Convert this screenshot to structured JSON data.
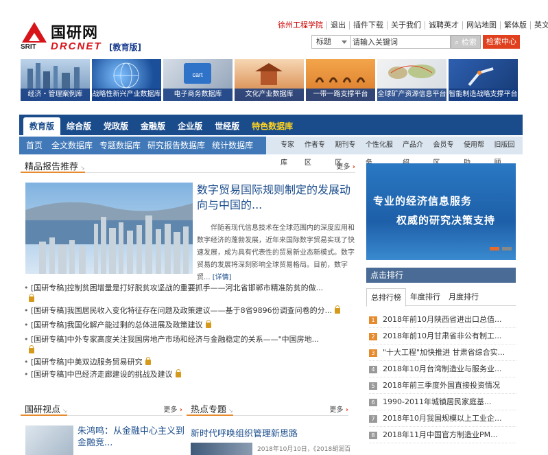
{
  "toplinks": [
    "徐州工程学院",
    "退出",
    "插件下载",
    "关于我们",
    "诚聘英才",
    "网站地图",
    "繁体版",
    "英文版"
  ],
  "logo": {
    "srit": "SRIT",
    "cn": "国研网",
    "en": "DRCNET",
    "edition": "[教育版]"
  },
  "search": {
    "select": "标题",
    "placeholder": "请输入关键词",
    "button": "检索",
    "center": "检索中心"
  },
  "banners": [
    "经济・管理案例库",
    "战略性新兴产业数据库",
    "电子商务数据库",
    "文化产业数据库",
    "一带一路支撑平台",
    "全球矿产资源信息平台",
    "智能制造战略支撑平台"
  ],
  "nav1": [
    "教育版",
    "综合版",
    "党政版",
    "金融版",
    "企业版",
    "世经版",
    "特色数据库"
  ],
  "nav2": {
    "main": [
      "首页",
      "全文数据库",
      "专题数据库",
      "研究报告数据库",
      "统计数据库"
    ],
    "subs": [
      "专家库",
      "作者专区",
      "期刊专区",
      "个性化服务",
      "产品介绍",
      "会员专区",
      "使用帮助",
      "旧版回顾"
    ]
  },
  "section1": {
    "title": "精品报告推荐",
    "more": "更多"
  },
  "featured": {
    "title": "数字贸易国际规则制定的发展动向与中国的...",
    "summary": "伴随着现代信息技术在全球范围内的深度应用和数字经济的蓬勃发展，近年来国际数字贸易实现了快速发展，成为具有代表性的贸易新业态新模式。数字贸易的发展将深刻影响全球贸易格局。目前，数字贸...",
    "detail": "[详情]"
  },
  "news": [
    "[国研专稿]控制贫困增量是打好脱贫攻坚战的重要抓手——河北省邯郸市精准防贫的做...",
    "[国研专稿]我国居民收入变化特征存在问题及政策建议——基于8省9896份调查问卷的分...",
    "[国研专稿]我国化解产能过剩的总体进展及政策建议",
    "[国研专稿]中外专家高度关注我国房地产市场和经济与金融稳定的关系——\"中国房地...",
    "[国研专稿]中美双边服务贸易研究",
    "[国研专稿]中巴经济走廊建设的挑战及建议"
  ],
  "promo": {
    "line1": "专业的经济信息服务",
    "line2": "权威的研究决策支持"
  },
  "rank": {
    "header": "点击排行",
    "tabs": [
      "总排行榜",
      "年度排行",
      "月度排行"
    ],
    "items": [
      {
        "n": "1",
        "t": "2018年前10月陕西省进出口总值..."
      },
      {
        "n": "2",
        "t": "2018年前10月甘肃省非公有制工..."
      },
      {
        "n": "3",
        "t": "\"十大工程\"加快推进 甘肃省综合实..."
      },
      {
        "n": "4",
        "t": "2018年10月台湾制造业与服务业..."
      },
      {
        "n": "5",
        "t": "2018年前三季度外国直接投资情况"
      },
      {
        "n": "6",
        "t": "1990-2011年城镇居民家庭基..."
      },
      {
        "n": "7",
        "t": "2018年10月我国规模以上工业企..."
      },
      {
        "n": "8",
        "t": "2018年11月中国官方制造业PM..."
      }
    ]
  },
  "section2": {
    "title": "国研视点",
    "more": "更多",
    "item_title": "朱鸿鸣：从金融中心主义到金融竞..."
  },
  "section3": {
    "title": "热点专题",
    "more": "更多",
    "item_title": "新时代呼唤组织管理新思路",
    "item_meta": "2018年10月10日，《2018胡润百"
  }
}
